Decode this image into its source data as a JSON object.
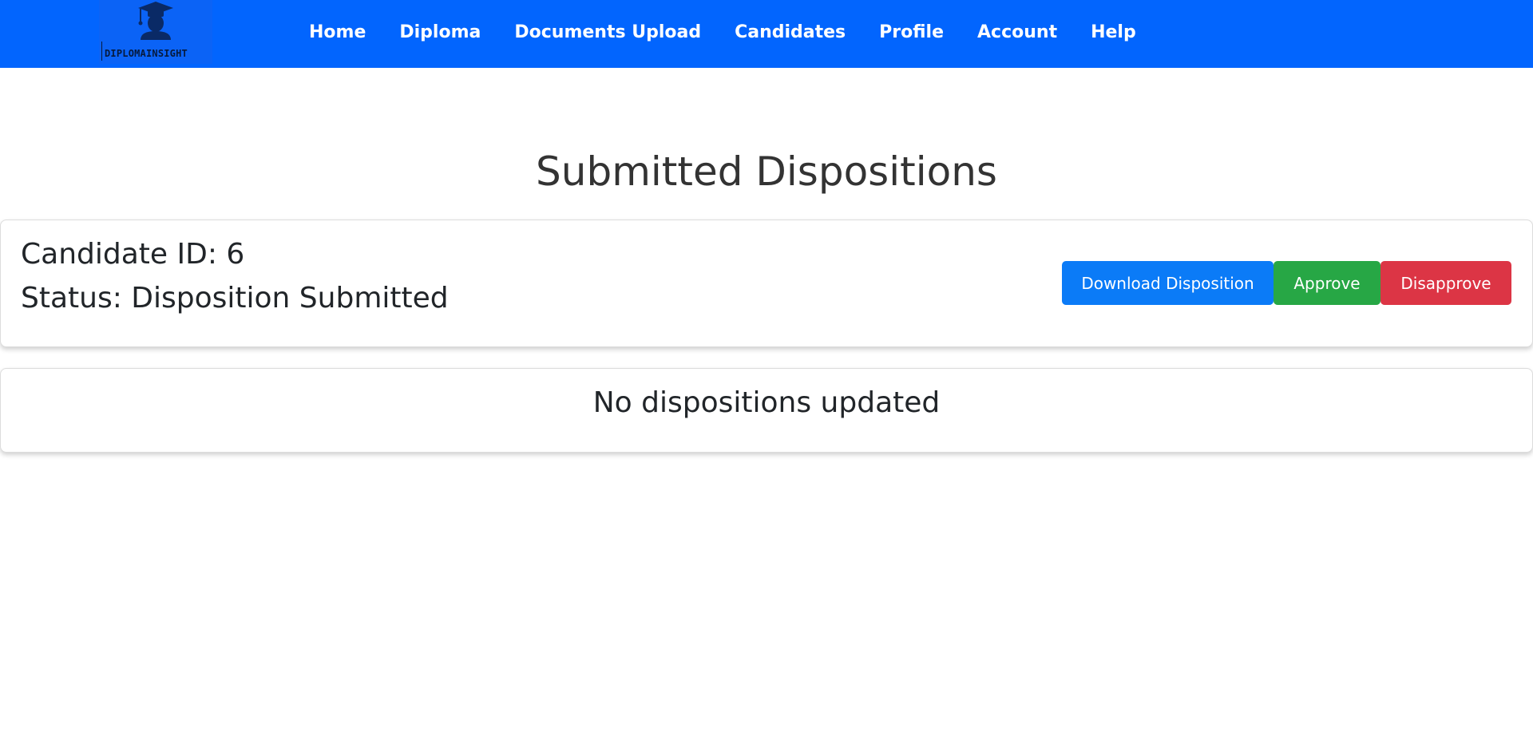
{
  "brand": {
    "name": "DIPLOMAINSIGHT",
    "icon": "graduate-icon"
  },
  "nav": {
    "items": [
      {
        "label": "Home"
      },
      {
        "label": "Diploma"
      },
      {
        "label": "Documents Upload"
      },
      {
        "label": "Candidates"
      },
      {
        "label": "Profile"
      },
      {
        "label": "Account"
      },
      {
        "label": "Help"
      }
    ]
  },
  "page": {
    "title": "Submitted Dispositions"
  },
  "submission": {
    "candidate_id_text": "Candidate ID: 6",
    "status_text": "Status: Disposition Submitted",
    "download_label": "Download Disposition",
    "approve_label": "Approve",
    "disapprove_label": "Disapprove"
  },
  "updated": {
    "empty_message": "No dispositions updated"
  },
  "colors": {
    "navbar": "#0265fe",
    "download": "#0b7bf7",
    "approve": "#27a745",
    "disapprove": "#dc3545"
  }
}
